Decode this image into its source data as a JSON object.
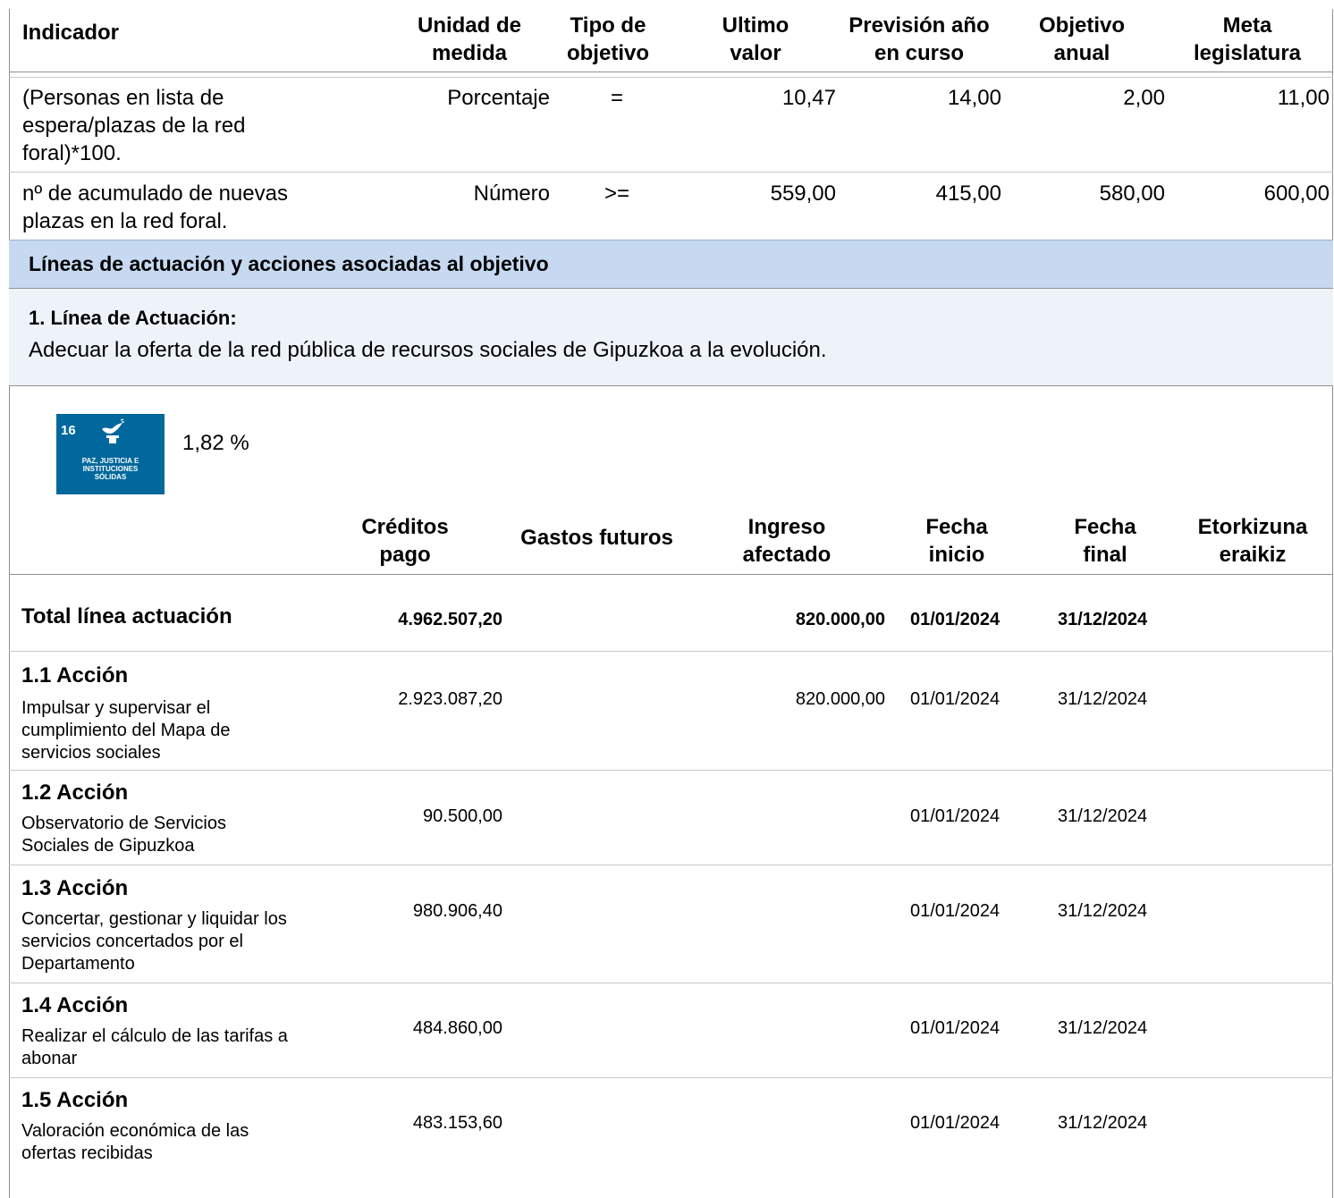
{
  "indicators": {
    "headers": {
      "indicador": "Indicador",
      "unidad": [
        "Unidad de",
        "medida"
      ],
      "tipo": [
        "Tipo de",
        "objetivo"
      ],
      "ultimo": [
        "Ultimo",
        "valor"
      ],
      "prevision": [
        "Previsión año",
        "en curso"
      ],
      "objetivo": [
        "Objetivo",
        "anual"
      ],
      "meta": [
        "Meta",
        "legislatura"
      ]
    },
    "rows": [
      {
        "indicador": [
          "(Personas en lista de",
          "espera/plazas de la red",
          "foral)*100."
        ],
        "unidad": "Porcentaje",
        "tipo": "=",
        "ultimo": "10,47",
        "prevision": "14,00",
        "objetivo": "2,00",
        "meta": "11,00"
      },
      {
        "indicador": [
          "nº de acumulado de nuevas",
          "plazas en la red foral."
        ],
        "unidad": "Número",
        "tipo": ">=",
        "ultimo": "559,00",
        "prevision": "415,00",
        "objetivo": "580,00",
        "meta": "600,00"
      }
    ]
  },
  "section_band": "Líneas de actuación y acciones asociadas al objetivo",
  "linea": {
    "title": "1. Línea de Actuación:",
    "description": "Adecuar la oferta de la red pública de recursos sociales de Gipuzkoa a la evolución."
  },
  "ods": {
    "number": "16",
    "label": [
      "PAZ, JUSTICIA E",
      "INSTITUCIONES",
      "SÓLIDAS"
    ],
    "percent": "1,82 %",
    "color": "#00689d",
    "icon": "dove-gavel-icon"
  },
  "actions_table": {
    "headers": {
      "creditos": [
        "Créditos",
        "pago"
      ],
      "gastos": "Gastos futuros",
      "ingreso": [
        "Ingreso",
        "afectado"
      ],
      "inicio": [
        "Fecha",
        "inicio"
      ],
      "final": [
        "Fecha",
        "final"
      ],
      "etorkizuna": [
        "Etorkizuna",
        "eraikiz"
      ]
    },
    "total": {
      "label": "Total línea actuación",
      "creditos": "4.962.507,20",
      "ingreso": "820.000,00",
      "inicio": "01/01/2024",
      "final": "31/12/2024"
    },
    "actions": [
      {
        "title": "1.1 Acción",
        "description": [
          "Impulsar y supervisar el",
          "cumplimiento del Mapa de",
          "servicios sociales"
        ],
        "creditos": "2.923.087,20",
        "ingreso": "820.000,00",
        "inicio": "01/01/2024",
        "final": "31/12/2024"
      },
      {
        "title": "1.2 Acción",
        "description": [
          "Observatorio de Servicios",
          "Sociales de Gipuzkoa"
        ],
        "creditos": "90.500,00",
        "ingreso": "",
        "inicio": "01/01/2024",
        "final": "31/12/2024"
      },
      {
        "title": "1.3 Acción",
        "description": [
          "Concertar, gestionar y liquidar los",
          "servicios concertados por el",
          "Departamento"
        ],
        "creditos": "980.906,40",
        "ingreso": "",
        "inicio": "01/01/2024",
        "final": "31/12/2024"
      },
      {
        "title": "1.4 Acción",
        "description": [
          "Realizar el cálculo de las tarifas a",
          "abonar"
        ],
        "creditos": "484.860,00",
        "ingreso": "",
        "inicio": "01/01/2024",
        "final": "31/12/2024"
      },
      {
        "title": "1.5 Acción",
        "description": [
          "Valoración económica de las",
          "ofertas recibidas"
        ],
        "creditos": "483.153,60",
        "ingreso": "",
        "inicio": "01/01/2024",
        "final": "31/12/2024"
      }
    ]
  }
}
